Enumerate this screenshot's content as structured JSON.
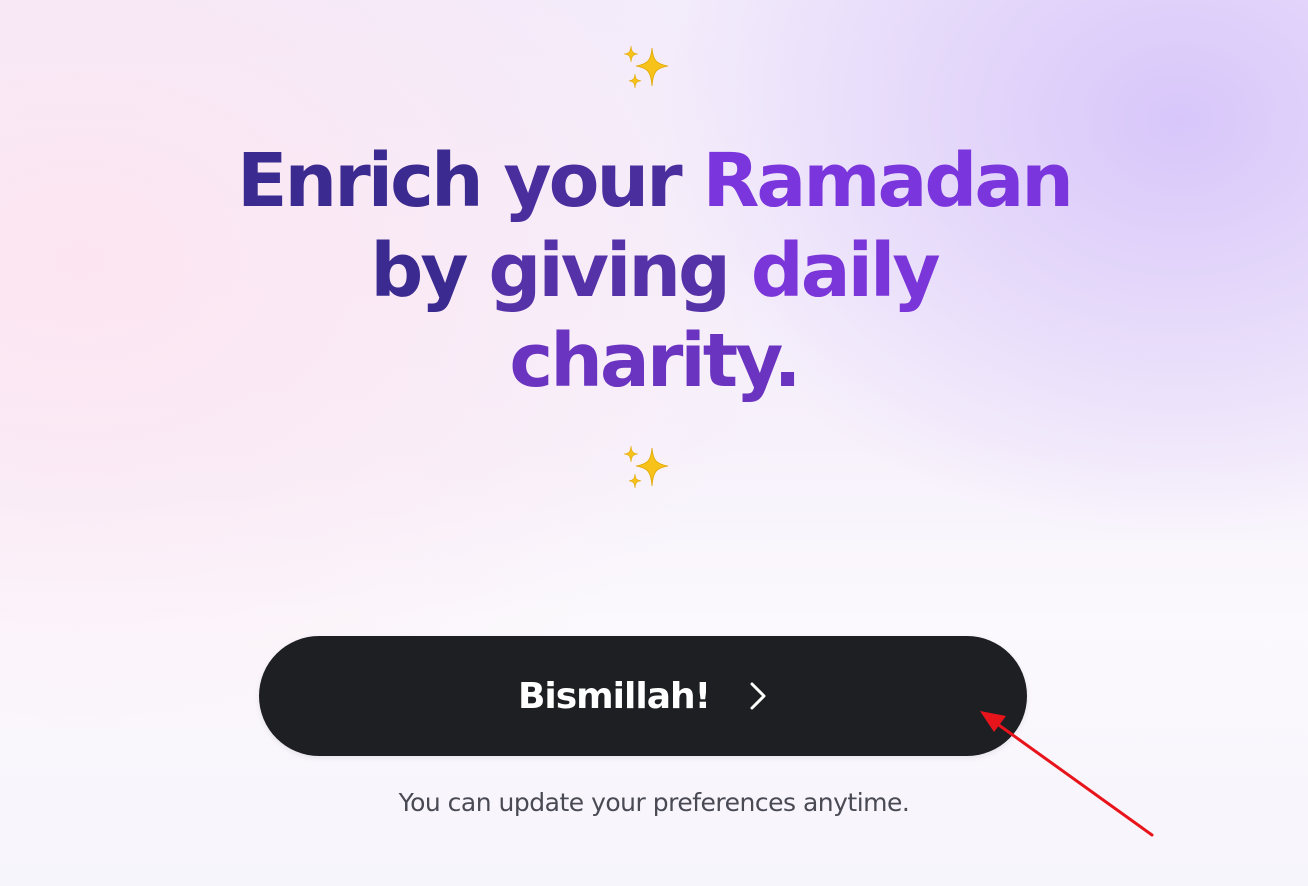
{
  "headline": {
    "words": [
      "Enrich",
      "your",
      "Ramadan",
      "by",
      "giving",
      "daily",
      "charity."
    ]
  },
  "cta": {
    "label": "Bismillah!"
  },
  "footer_note": "You can update your preferences anytime.",
  "icons": {
    "decoration": "sparkles-icon",
    "cta": "chevron-right-icon",
    "annotation": "red-arrow"
  },
  "colors": {
    "headline_dark": "#3b2a8f",
    "headline_purple": "#7b35dc",
    "button_bg": "#1e1f23",
    "button_text": "#ffffff",
    "note_text": "#4a4a55",
    "sparkle": "#f5c518",
    "annotation_arrow": "#e8141c"
  }
}
